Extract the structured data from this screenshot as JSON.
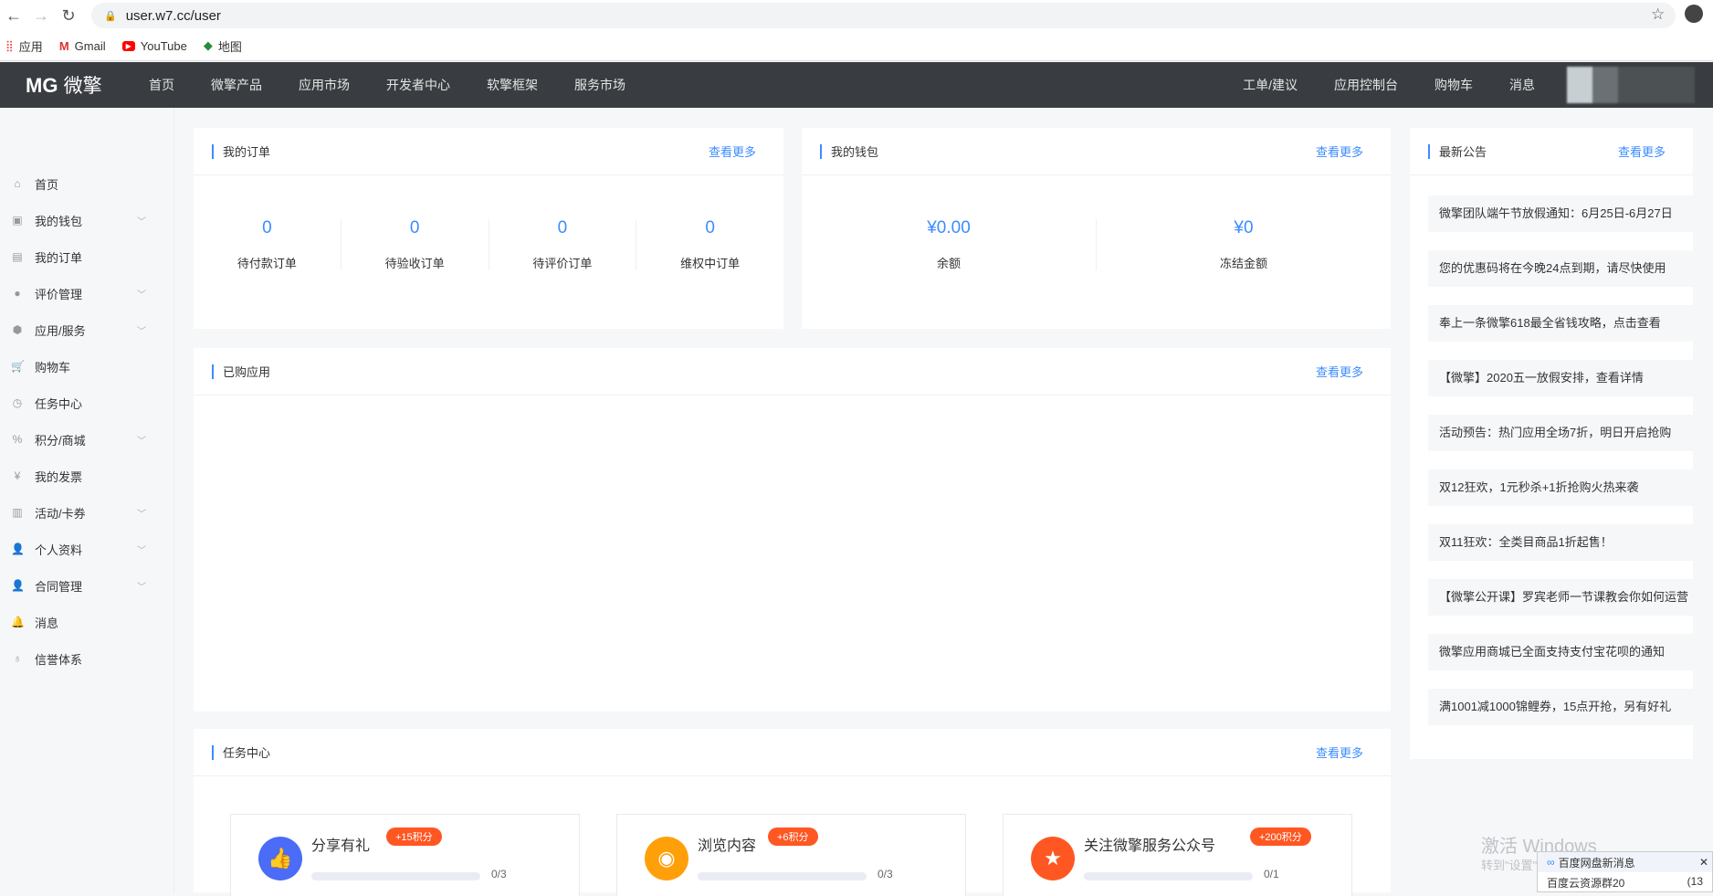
{
  "browser": {
    "url": "user.w7.cc/user",
    "bookmarks": [
      "应用",
      "Gmail",
      "YouTube",
      "地图"
    ]
  },
  "topnav": {
    "logo_mark": "MG",
    "logo_text": "微擎",
    "items": [
      "首页",
      "微擎产品",
      "应用市场",
      "开发者中心",
      "软擎框架",
      "服务市场"
    ],
    "right_items": [
      "工单/建议",
      "应用控制台",
      "购物车",
      "消息"
    ]
  },
  "sidebar": {
    "items": [
      {
        "label": "首页",
        "icon": "home-icon",
        "glyph": "⌂",
        "expand": false
      },
      {
        "label": "我的钱包",
        "icon": "wallet-icon",
        "glyph": "▣",
        "expand": true
      },
      {
        "label": "我的订单",
        "icon": "clipboard-icon",
        "glyph": "▤",
        "expand": false
      },
      {
        "label": "评价管理",
        "icon": "comment-icon",
        "glyph": "●",
        "expand": true
      },
      {
        "label": "应用/服务",
        "icon": "cube-icon",
        "glyph": "⬢",
        "expand": true
      },
      {
        "label": "购物车",
        "icon": "cart-icon",
        "glyph": "🛒",
        "expand": false
      },
      {
        "label": "任务中心",
        "icon": "clock-icon",
        "glyph": "◷",
        "expand": false
      },
      {
        "label": "积分/商城",
        "icon": "percent-icon",
        "glyph": "%",
        "expand": true
      },
      {
        "label": "我的发票",
        "icon": "invoice-icon",
        "glyph": "¥",
        "expand": false
      },
      {
        "label": "活动/卡券",
        "icon": "gift-icon",
        "glyph": "▥",
        "expand": true
      },
      {
        "label": "个人资料",
        "icon": "user-icon",
        "glyph": "👤",
        "expand": true
      },
      {
        "label": "合同管理",
        "icon": "user-icon",
        "glyph": "👤",
        "expand": true
      },
      {
        "label": "消息",
        "icon": "bell-icon",
        "glyph": "🔔",
        "expand": false
      },
      {
        "label": "信誉体系",
        "icon": "medal-icon",
        "glyph": "♁",
        "expand": false
      }
    ]
  },
  "orders": {
    "title": "我的订单",
    "more": "查看更多",
    "stats": [
      {
        "value": "0",
        "label": "待付款订单"
      },
      {
        "value": "0",
        "label": "待验收订单"
      },
      {
        "value": "0",
        "label": "待评价订单"
      },
      {
        "value": "0",
        "label": "维权中订单"
      }
    ]
  },
  "wallet": {
    "title": "我的钱包",
    "more": "查看更多",
    "stats": [
      {
        "value": "¥0.00",
        "label": "余额"
      },
      {
        "value": "¥0",
        "label": "冻结金额"
      }
    ]
  },
  "purchased": {
    "title": "已购应用",
    "more": "查看更多"
  },
  "announcements": {
    "title": "最新公告",
    "more": "查看更多",
    "items": [
      "微擎团队端午节放假通知：6月25日-6月27日",
      "您的优惠码将在今晚24点到期，请尽快使用",
      "奉上一条微擎618最全省钱攻略，点击查看",
      "【微擎】2020五一放假安排，查看详情",
      "活动预告：热门应用全场7折，明日开启抢购",
      "双12狂欢，1元秒杀+1折抢购火热来袭",
      "双11狂欢：全类目商品1折起售！",
      "【微擎公开课】罗宾老师一节课教会你如何运营",
      "微擎应用商城已全面支持支付宝花呗的通知",
      "满1001减1000锦鲤券，15点开抢，另有好礼"
    ]
  },
  "tasks": {
    "title": "任务中心",
    "more": "查看更多",
    "items": [
      {
        "name": "分享有礼",
        "badge": "+15积分",
        "progress": "0/3",
        "done": 0,
        "total": 3,
        "icon": "thumbs-up-icon",
        "glyph": "👍",
        "color": "#4a6cf7"
      },
      {
        "name": "浏览内容",
        "badge": "+6积分",
        "progress": "0/3",
        "done": 0,
        "total": 3,
        "icon": "eye-icon",
        "glyph": "◉",
        "color": "#ff9f0a"
      },
      {
        "name": "关注微擎服务公众号",
        "badge": "+200积分",
        "progress": "0/1",
        "done": 0,
        "total": 1,
        "icon": "star-icon",
        "glyph": "★",
        "color": "#ff5722"
      }
    ]
  },
  "overlay": {
    "windows_title": "激活 Windows",
    "windows_sub": "转到\"设置\"以激活 Windows。",
    "toast_title": "百度网盘新消息",
    "toast_body": "百度云资源群20",
    "toast_count": "(13"
  }
}
